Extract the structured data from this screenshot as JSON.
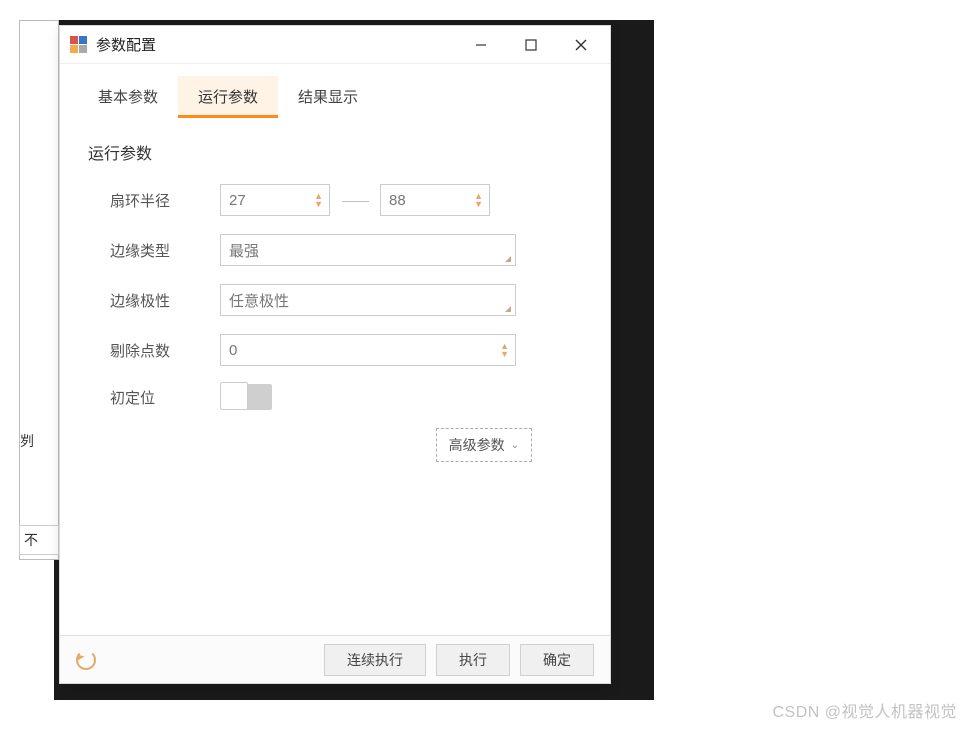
{
  "titlebar": {
    "title": "参数配置"
  },
  "tabs": {
    "basic": "基本参数",
    "run": "运行参数",
    "result": "结果显示"
  },
  "section": {
    "heading": "运行参数",
    "ring_radius_label": "扇环半径",
    "ring_radius_min": "27",
    "ring_radius_max": "88",
    "edge_type_label": "边缘类型",
    "edge_type_value": "最强",
    "edge_polarity_label": "边缘极性",
    "edge_polarity_value": "任意极性",
    "reject_points_label": "剔除点数",
    "reject_points_value": "0",
    "init_locate_label": "初定位",
    "advanced": "高级参数"
  },
  "footer": {
    "continuous": "连续执行",
    "execute": "执行",
    "ok": "确定"
  },
  "watermark": "CSDN @视觉人机器视觉"
}
